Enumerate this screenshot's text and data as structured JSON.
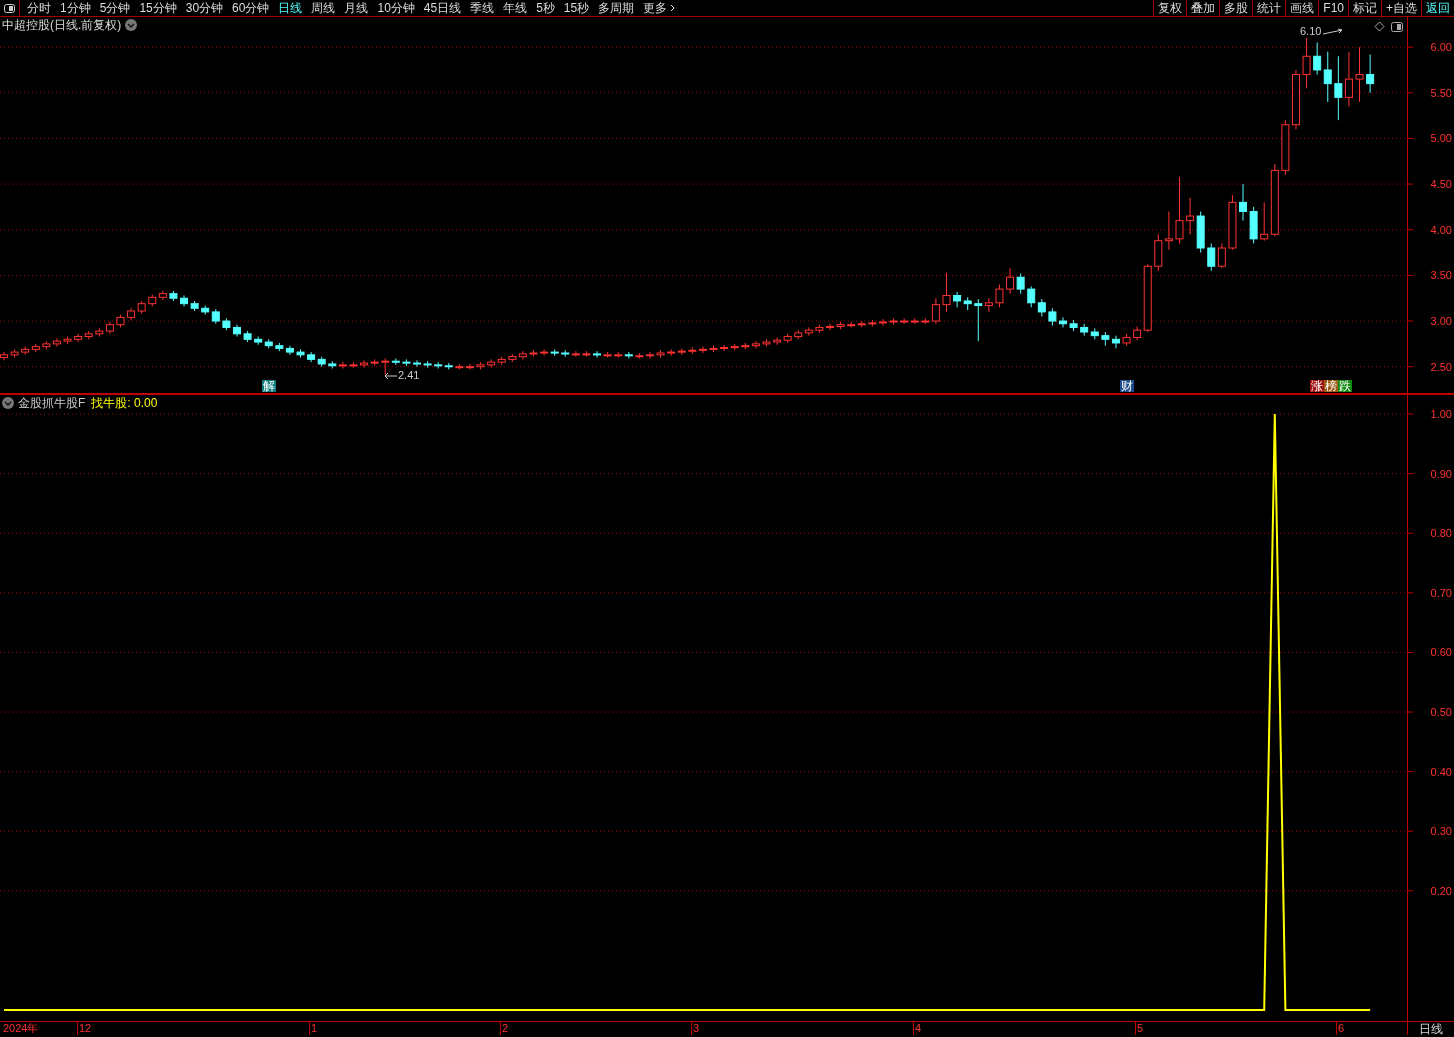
{
  "toolbar": {
    "periods": [
      {
        "label": "分时",
        "selected": false
      },
      {
        "label": "1分钟",
        "selected": false
      },
      {
        "label": "5分钟",
        "selected": false
      },
      {
        "label": "15分钟",
        "selected": false
      },
      {
        "label": "30分钟",
        "selected": false
      },
      {
        "label": "60分钟",
        "selected": false
      },
      {
        "label": "日线",
        "selected": true
      },
      {
        "label": "周线",
        "selected": false
      },
      {
        "label": "月线",
        "selected": false
      },
      {
        "label": "10分钟",
        "selected": false
      },
      {
        "label": "45日线",
        "selected": false
      },
      {
        "label": "季线",
        "selected": false
      },
      {
        "label": "年线",
        "selected": false
      },
      {
        "label": "5秒",
        "selected": false
      },
      {
        "label": "15秒",
        "selected": false
      },
      {
        "label": "多周期",
        "selected": false
      }
    ],
    "more": "更多",
    "tools": [
      {
        "label": "复权",
        "highlighted": false
      },
      {
        "label": "叠加",
        "highlighted": false
      },
      {
        "label": "多股",
        "highlighted": false
      },
      {
        "label": "统计",
        "highlighted": false
      },
      {
        "label": "画线",
        "highlighted": false
      },
      {
        "label": "F10",
        "highlighted": false
      },
      {
        "label": "标记",
        "highlighted": false
      },
      {
        "label": "+自选",
        "highlighted": false
      },
      {
        "label": "返回",
        "highlighted": true
      }
    ]
  },
  "main_pane": {
    "title": "中超控股(日线.前复权)",
    "high_label": "6.10",
    "low_label": "2.41",
    "badges": [
      {
        "text": "解",
        "color": "#0e7c7c"
      },
      {
        "text": "财",
        "color": "#1c4a8a"
      },
      {
        "text": "涨",
        "color": "#a01414"
      },
      {
        "text": "榜",
        "color": "#9a5a14"
      },
      {
        "text": "跌",
        "color": "#138a13"
      }
    ],
    "chart_data": {
      "type": "candlestick",
      "grid": true,
      "ylim": [
        2.19,
        6.33
      ],
      "yticks": [
        {
          "value": 6,
          "label": "6.00"
        },
        {
          "value": 5.5,
          "label": "5.50"
        },
        {
          "value": 5,
          "label": "5.00"
        },
        {
          "value": 4.5,
          "label": "4.50"
        },
        {
          "value": 4,
          "label": "4.00"
        },
        {
          "value": 3.5,
          "label": "3.50"
        },
        {
          "value": 3,
          "label": "3.00"
        },
        {
          "value": 2.5,
          "label": "2.50"
        }
      ],
      "ohlc": [
        [
          2.6,
          2.66,
          2.57,
          2.63
        ],
        [
          2.63,
          2.69,
          2.6,
          2.66
        ],
        [
          2.66,
          2.72,
          2.63,
          2.69
        ],
        [
          2.69,
          2.75,
          2.66,
          2.72
        ],
        [
          2.72,
          2.78,
          2.69,
          2.75
        ],
        [
          2.75,
          2.81,
          2.72,
          2.78
        ],
        [
          2.78,
          2.83,
          2.75,
          2.8
        ],
        [
          2.8,
          2.86,
          2.77,
          2.83
        ],
        [
          2.83,
          2.89,
          2.8,
          2.86
        ],
        [
          2.86,
          2.92,
          2.83,
          2.89
        ],
        [
          2.89,
          2.99,
          2.86,
          2.96
        ],
        [
          2.96,
          3.07,
          2.93,
          3.04
        ],
        [
          3.04,
          3.14,
          3.01,
          3.11
        ],
        [
          3.11,
          3.22,
          3.08,
          3.19
        ],
        [
          3.19,
          3.29,
          3.16,
          3.26
        ],
        [
          3.26,
          3.33,
          3.23,
          3.3
        ],
        [
          3.3,
          3.33,
          3.22,
          3.25
        ],
        [
          3.25,
          3.28,
          3.16,
          3.19
        ],
        [
          3.19,
          3.22,
          3.11,
          3.14
        ],
        [
          3.14,
          3.17,
          3.07,
          3.1
        ],
        [
          3.1,
          3.13,
          2.97,
          3.0
        ],
        [
          3.0,
          3.03,
          2.9,
          2.93
        ],
        [
          2.93,
          2.96,
          2.83,
          2.86
        ],
        [
          2.86,
          2.89,
          2.77,
          2.8
        ],
        [
          2.8,
          2.83,
          2.74,
          2.77
        ],
        [
          2.77,
          2.8,
          2.7,
          2.73
        ],
        [
          2.73,
          2.76,
          2.67,
          2.7
        ],
        [
          2.7,
          2.73,
          2.63,
          2.66
        ],
        [
          2.66,
          2.69,
          2.6,
          2.63
        ],
        [
          2.63,
          2.66,
          2.55,
          2.58
        ],
        [
          2.58,
          2.61,
          2.5,
          2.53
        ],
        [
          2.53,
          2.56,
          2.48,
          2.51
        ],
        [
          2.51,
          2.55,
          2.48,
          2.52
        ],
        [
          2.52,
          2.55,
          2.49,
          2.52
        ],
        [
          2.52,
          2.57,
          2.49,
          2.54
        ],
        [
          2.54,
          2.58,
          2.51,
          2.55
        ],
        [
          2.55,
          2.59,
          2.41,
          2.56
        ],
        [
          2.56,
          2.59,
          2.52,
          2.55
        ],
        [
          2.55,
          2.58,
          2.51,
          2.54
        ],
        [
          2.54,
          2.57,
          2.5,
          2.53
        ],
        [
          2.53,
          2.56,
          2.49,
          2.52
        ],
        [
          2.52,
          2.55,
          2.48,
          2.51
        ],
        [
          2.51,
          2.54,
          2.47,
          2.5
        ],
        [
          2.5,
          2.53,
          2.47,
          2.5
        ],
        [
          2.5,
          2.53,
          2.47,
          2.5
        ],
        [
          2.5,
          2.55,
          2.47,
          2.52
        ],
        [
          2.52,
          2.58,
          2.49,
          2.55
        ],
        [
          2.55,
          2.61,
          2.52,
          2.58
        ],
        [
          2.58,
          2.64,
          2.55,
          2.61
        ],
        [
          2.61,
          2.67,
          2.58,
          2.64
        ],
        [
          2.64,
          2.68,
          2.61,
          2.65
        ],
        [
          2.65,
          2.69,
          2.62,
          2.66
        ],
        [
          2.66,
          2.69,
          2.62,
          2.65
        ],
        [
          2.65,
          2.68,
          2.61,
          2.64
        ],
        [
          2.64,
          2.67,
          2.61,
          2.64
        ],
        [
          2.64,
          2.67,
          2.61,
          2.64
        ],
        [
          2.64,
          2.67,
          2.6,
          2.63
        ],
        [
          2.63,
          2.66,
          2.6,
          2.63
        ],
        [
          2.63,
          2.66,
          2.6,
          2.63
        ],
        [
          2.63,
          2.66,
          2.59,
          2.62
        ],
        [
          2.62,
          2.65,
          2.59,
          2.62
        ],
        [
          2.62,
          2.66,
          2.59,
          2.63
        ],
        [
          2.63,
          2.68,
          2.6,
          2.65
        ],
        [
          2.65,
          2.69,
          2.62,
          2.66
        ],
        [
          2.66,
          2.7,
          2.63,
          2.67
        ],
        [
          2.67,
          2.71,
          2.64,
          2.68
        ],
        [
          2.68,
          2.72,
          2.65,
          2.69
        ],
        [
          2.69,
          2.73,
          2.66,
          2.7
        ],
        [
          2.7,
          2.74,
          2.67,
          2.71
        ],
        [
          2.71,
          2.75,
          2.68,
          2.72
        ],
        [
          2.72,
          2.76,
          2.69,
          2.73
        ],
        [
          2.73,
          2.78,
          2.7,
          2.75
        ],
        [
          2.75,
          2.8,
          2.72,
          2.77
        ],
        [
          2.77,
          2.82,
          2.74,
          2.79
        ],
        [
          2.79,
          2.86,
          2.76,
          2.83
        ],
        [
          2.83,
          2.9,
          2.8,
          2.87
        ],
        [
          2.87,
          2.93,
          2.84,
          2.9
        ],
        [
          2.9,
          2.96,
          2.87,
          2.93
        ],
        [
          2.93,
          2.97,
          2.9,
          2.94
        ],
        [
          2.94,
          2.99,
          2.91,
          2.96
        ],
        [
          2.96,
          2.99,
          2.93,
          2.96
        ],
        [
          2.96,
          3.0,
          2.93,
          2.97
        ],
        [
          2.97,
          3.01,
          2.94,
          2.98
        ],
        [
          2.98,
          3.02,
          2.95,
          2.99
        ],
        [
          2.99,
          3.03,
          2.96,
          3.0
        ],
        [
          3.0,
          3.03,
          2.97,
          3.0
        ],
        [
          3.0,
          3.03,
          2.97,
          3.0
        ],
        [
          3.0,
          3.03,
          2.97,
          3.0
        ],
        [
          3.0,
          3.25,
          2.97,
          3.18
        ],
        [
          3.18,
          3.53,
          3.1,
          3.28
        ],
        [
          3.28,
          3.32,
          3.15,
          3.22
        ],
        [
          3.22,
          3.26,
          3.12,
          3.19
        ],
        [
          3.19,
          3.24,
          2.78,
          3.17
        ],
        [
          3.17,
          3.25,
          3.1,
          3.2
        ],
        [
          3.2,
          3.4,
          3.15,
          3.35
        ],
        [
          3.35,
          3.58,
          3.3,
          3.48
        ],
        [
          3.48,
          3.52,
          3.3,
          3.35
        ],
        [
          3.35,
          3.38,
          3.15,
          3.2
        ],
        [
          3.2,
          3.24,
          3.05,
          3.1
        ],
        [
          3.1,
          3.14,
          2.95,
          3.0
        ],
        [
          3.0,
          3.04,
          2.93,
          2.97
        ],
        [
          2.97,
          3.01,
          2.89,
          2.93
        ],
        [
          2.93,
          2.97,
          2.84,
          2.88
        ],
        [
          2.88,
          2.92,
          2.8,
          2.84
        ],
        [
          2.84,
          2.88,
          2.73,
          2.8
        ],
        [
          2.8,
          2.84,
          2.7,
          2.76
        ],
        [
          2.76,
          2.86,
          2.73,
          2.82
        ],
        [
          2.82,
          2.94,
          2.79,
          2.9
        ],
        [
          2.9,
          3.62,
          2.88,
          3.6
        ],
        [
          3.6,
          3.95,
          3.55,
          3.88
        ],
        [
          3.88,
          4.2,
          3.78,
          3.9
        ],
        [
          3.9,
          4.58,
          3.85,
          4.1
        ],
        [
          4.1,
          4.35,
          3.95,
          4.15
        ],
        [
          4.15,
          4.2,
          3.75,
          3.8
        ],
        [
          3.8,
          3.85,
          3.55,
          3.6
        ],
        [
          3.6,
          3.85,
          3.58,
          3.8
        ],
        [
          3.8,
          4.38,
          3.78,
          4.3
        ],
        [
          4.3,
          4.5,
          4.1,
          4.2
        ],
        [
          4.2,
          4.25,
          3.85,
          3.9
        ],
        [
          3.9,
          4.3,
          3.88,
          3.95
        ],
        [
          3.95,
          4.72,
          3.93,
          4.65
        ],
        [
          4.65,
          5.2,
          4.6,
          5.15
        ],
        [
          5.15,
          5.75,
          5.1,
          5.7
        ],
        [
          5.7,
          6.1,
          5.55,
          5.9
        ],
        [
          5.9,
          6.05,
          5.7,
          5.75
        ],
        [
          5.75,
          5.95,
          5.4,
          5.6
        ],
        [
          5.6,
          5.9,
          5.2,
          5.45
        ],
        [
          5.45,
          5.95,
          5.35,
          5.65
        ],
        [
          5.65,
          6.0,
          5.4,
          5.7
        ],
        [
          5.7,
          5.92,
          5.5,
          5.6
        ]
      ]
    }
  },
  "indicator_pane": {
    "name": "金股抓牛股F",
    "output_value": ": 0.00",
    "chart_data": {
      "type": "line",
      "grid": true,
      "ylim": [
        -0.0436,
        1.032
      ],
      "yticks": [
        {
          "value": 1,
          "label": "1.00"
        },
        {
          "value": 0.9,
          "label": "0.90"
        },
        {
          "value": 0.8,
          "label": "0.80"
        },
        {
          "value": 0.7,
          "label": "0.70"
        },
        {
          "value": 0.6,
          "label": "0.60"
        },
        {
          "value": 0.5,
          "label": "0.50"
        },
        {
          "value": 0.4,
          "label": "0.40"
        },
        {
          "value": 0.3,
          "label": "0.30"
        },
        {
          "value": 0.2,
          "label": "0.20"
        }
      ],
      "series": [
        {
          "name": "找牛股",
          "color": "#ffff00",
          "values": [
            0,
            0,
            0,
            0,
            0,
            0,
            0,
            0,
            0,
            0,
            0,
            0,
            0,
            0,
            0,
            0,
            0,
            0,
            0,
            0,
            0,
            0,
            0,
            0,
            0,
            0,
            0,
            0,
            0,
            0,
            0,
            0,
            0,
            0,
            0,
            0,
            0,
            0,
            0,
            0,
            0,
            0,
            0,
            0,
            0,
            0,
            0,
            0,
            0,
            0,
            0,
            0,
            0,
            0,
            0,
            0,
            0,
            0,
            0,
            0,
            0,
            0,
            0,
            0,
            0,
            0,
            0,
            0,
            0,
            0,
            0,
            0,
            0,
            0,
            0,
            0,
            0,
            0,
            0,
            0,
            0,
            0,
            0,
            0,
            0,
            0,
            0,
            0,
            0,
            0,
            0,
            0,
            0,
            0,
            0,
            0,
            0,
            0,
            0,
            0,
            0,
            0,
            0,
            0,
            0,
            0,
            0,
            0,
            0,
            0,
            0,
            0,
            0,
            0,
            0,
            0,
            0,
            0,
            0,
            0,
            1,
            0,
            0,
            0,
            0,
            0,
            0,
            0,
            0,
            0
          ]
        }
      ]
    }
  },
  "time_axis": {
    "year": "2024年",
    "months": [
      "12",
      "1",
      "2",
      "3",
      "4",
      "5",
      "6"
    ],
    "period": "日线"
  }
}
